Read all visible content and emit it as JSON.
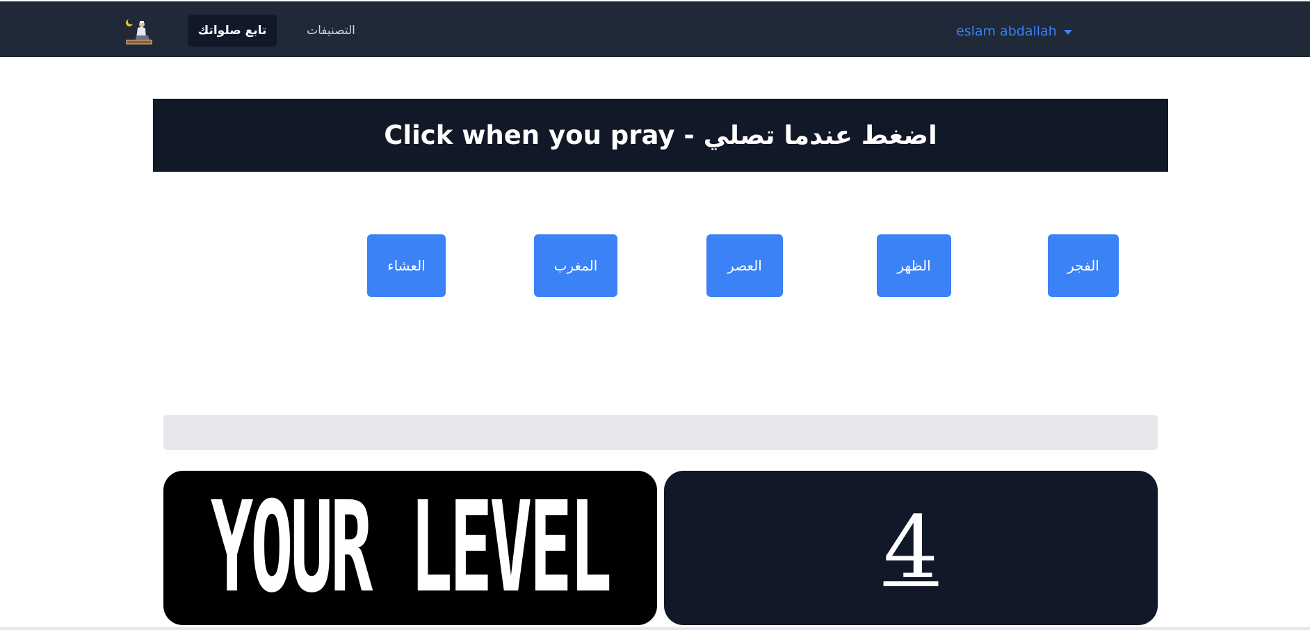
{
  "navbar": {
    "logo_icon": "praying-person-icon",
    "active_link": "تابع صلواتك",
    "link": "التصنيفات",
    "user_name": "eslam abdallah",
    "colors": {
      "bg": "#1f2937",
      "active_bg": "#111827",
      "user": "#3b82f6"
    }
  },
  "banner": {
    "title": "Click when you pray - اضغط عندما تصلي"
  },
  "prayers": {
    "fajr": "الفجر",
    "dhuhr": "الظهر",
    "asr": "العصر",
    "maghrib": "المغرب",
    "isha": "العشاء",
    "button_color": "#3b82f6"
  },
  "progress": {
    "percent": 0
  },
  "level": {
    "image_text": "YOUR LEVEL",
    "value": "4"
  }
}
